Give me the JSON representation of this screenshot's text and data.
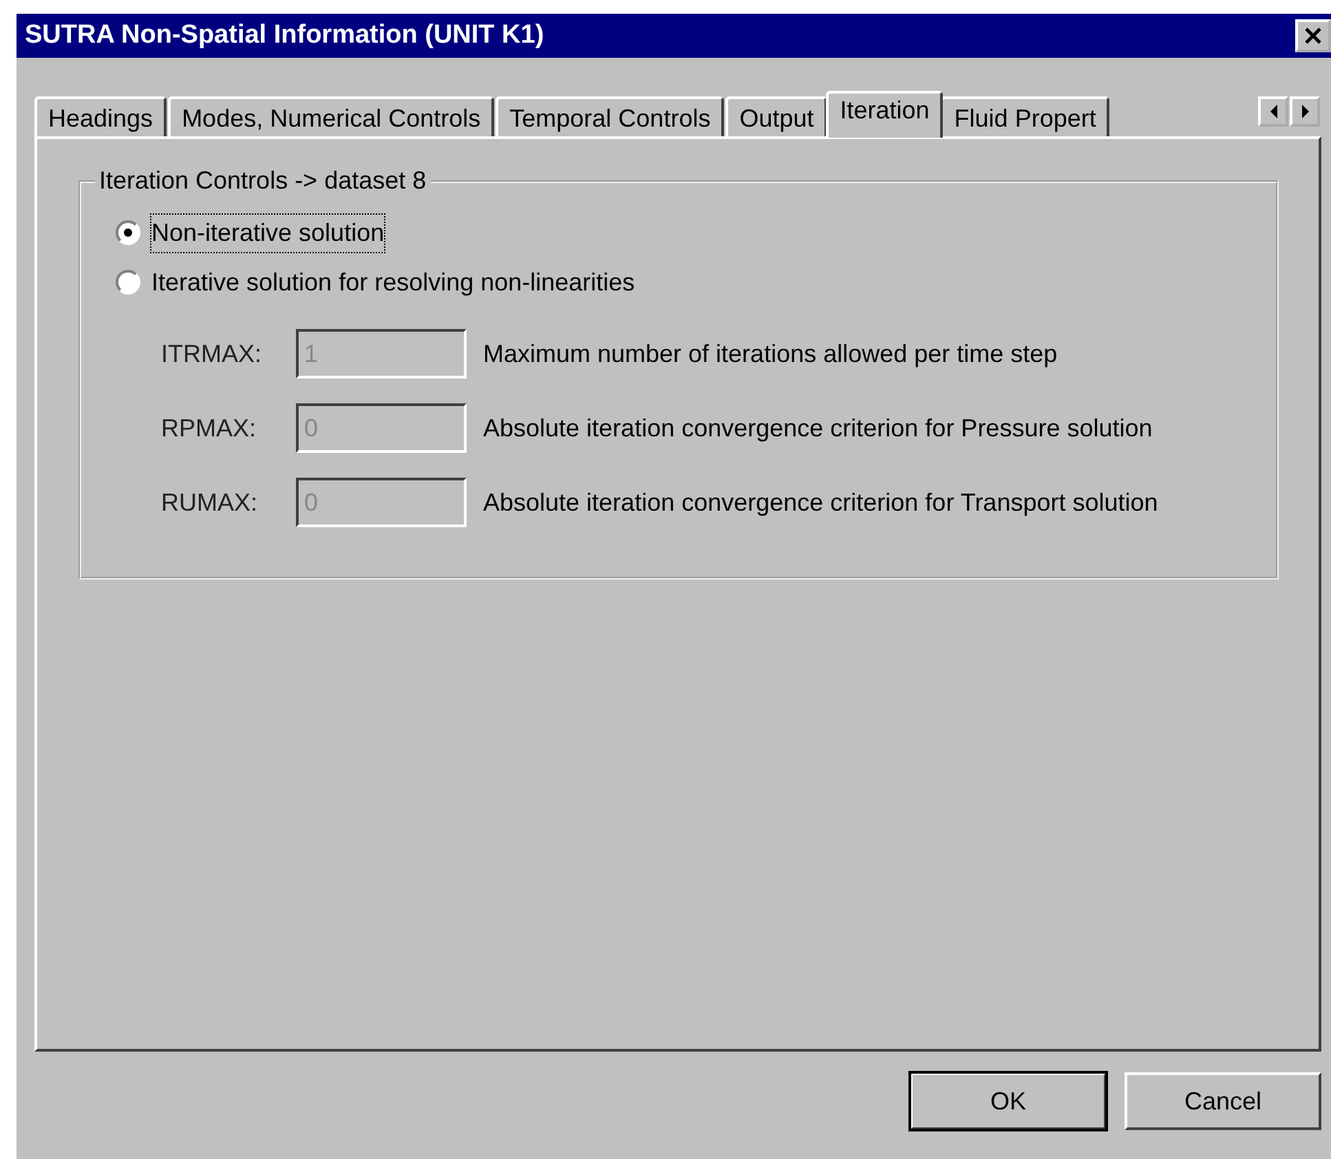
{
  "window": {
    "title": "SUTRA Non-Spatial Information (UNIT K1)"
  },
  "tabs": [
    {
      "label": "Headings",
      "selected": false
    },
    {
      "label": "Modes, Numerical Controls",
      "selected": false
    },
    {
      "label": "Temporal Controls",
      "selected": false
    },
    {
      "label": "Output",
      "selected": false
    },
    {
      "label": "Iteration",
      "selected": true
    },
    {
      "label": "Fluid Propert",
      "selected": false
    }
  ],
  "group": {
    "title": "Iteration Controls -> dataset 8",
    "options": [
      {
        "label": "Non-iterative solution",
        "selected": true,
        "focused": true
      },
      {
        "label": "Iterative solution for resolving non-linearities",
        "selected": false,
        "focused": false
      }
    ],
    "fields": [
      {
        "label": "ITRMAX:",
        "value": "1",
        "description": "Maximum number of iterations allowed per time step",
        "disabled": true
      },
      {
        "label": "RPMAX:",
        "value": "0",
        "description": "Absolute iteration convergence criterion for Pressure solution",
        "disabled": true
      },
      {
        "label": "RUMAX:",
        "value": "0",
        "description": "Absolute iteration convergence criterion for Transport solution",
        "disabled": true
      }
    ]
  },
  "buttons": [
    {
      "label": "OK",
      "default": true
    },
    {
      "label": "Cancel",
      "default": false
    }
  ]
}
